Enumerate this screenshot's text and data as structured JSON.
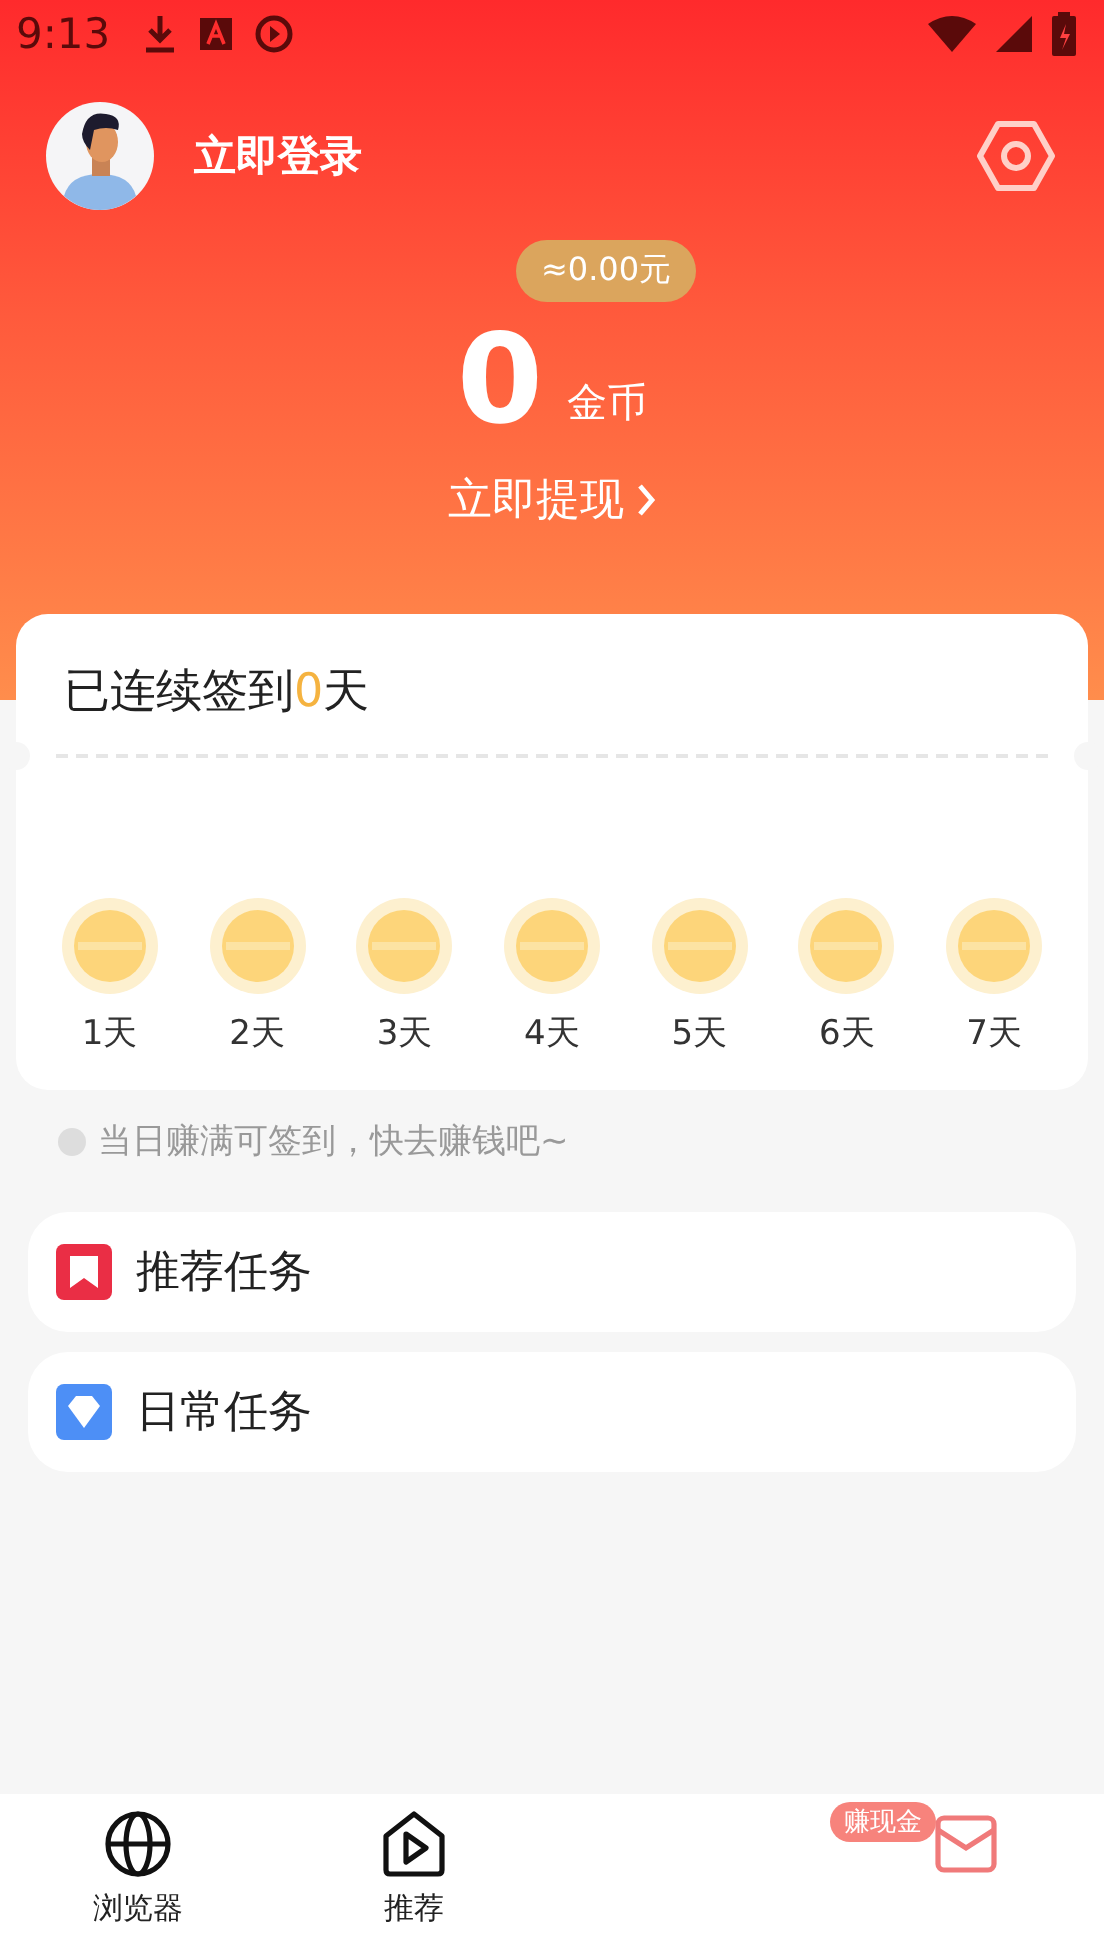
{
  "status_bar": {
    "time": "9:13"
  },
  "profile": {
    "login_label": "立即登录"
  },
  "balance": {
    "cash": "≈0.00元",
    "coins": "0",
    "coin_unit": "金币",
    "withdraw": "立即提现"
  },
  "checkin": {
    "title_prefix": "已连续签到",
    "streak": "0",
    "title_suffix": "天",
    "days": [
      {
        "label": "1天"
      },
      {
        "label": "2天"
      },
      {
        "label": "3天"
      },
      {
        "label": "4天"
      },
      {
        "label": "5天"
      },
      {
        "label": "6天"
      },
      {
        "label": "7天"
      }
    ]
  },
  "hint": "当日赚满可签到，快去赚钱吧~",
  "tasks": [
    {
      "label": "推荐任务",
      "kind": "recommended"
    },
    {
      "label": "日常任务",
      "kind": "daily"
    }
  ],
  "nav": [
    {
      "label": "浏览器",
      "kind": "browser"
    },
    {
      "label": "推荐",
      "kind": "recommend"
    },
    {
      "kind": "empty"
    },
    {
      "kind": "mail",
      "badge": "赚现金"
    }
  ]
}
